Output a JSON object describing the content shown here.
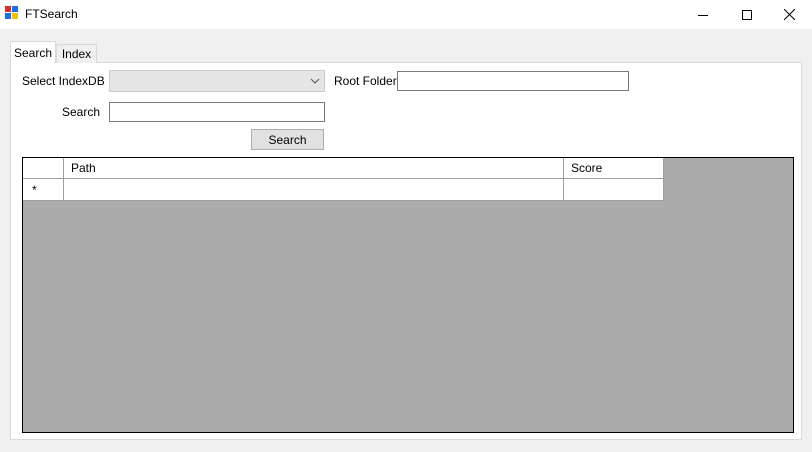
{
  "window": {
    "title": "FTSearch",
    "icon": "app-icon",
    "controls": [
      "minimize-icon",
      "maximize-icon",
      "close-icon"
    ]
  },
  "tabs": [
    {
      "label": "Search",
      "selected": true
    },
    {
      "label": "Index",
      "selected": false
    }
  ],
  "search_form": {
    "select_indexdb_label": "Select IndexDB",
    "select_indexdb_value": "",
    "root_folder_label": "Root Folder",
    "root_folder_value": "",
    "search_label": "Search",
    "search_value": "",
    "search_button_label": "Search"
  },
  "results_grid": {
    "columns": [
      "Path",
      "Score"
    ],
    "new_row_marker": "*",
    "rows": []
  },
  "colors": {
    "grid_background": "#ababab",
    "panel_background": "#ffffff",
    "window_background": "#f0f0f0"
  }
}
